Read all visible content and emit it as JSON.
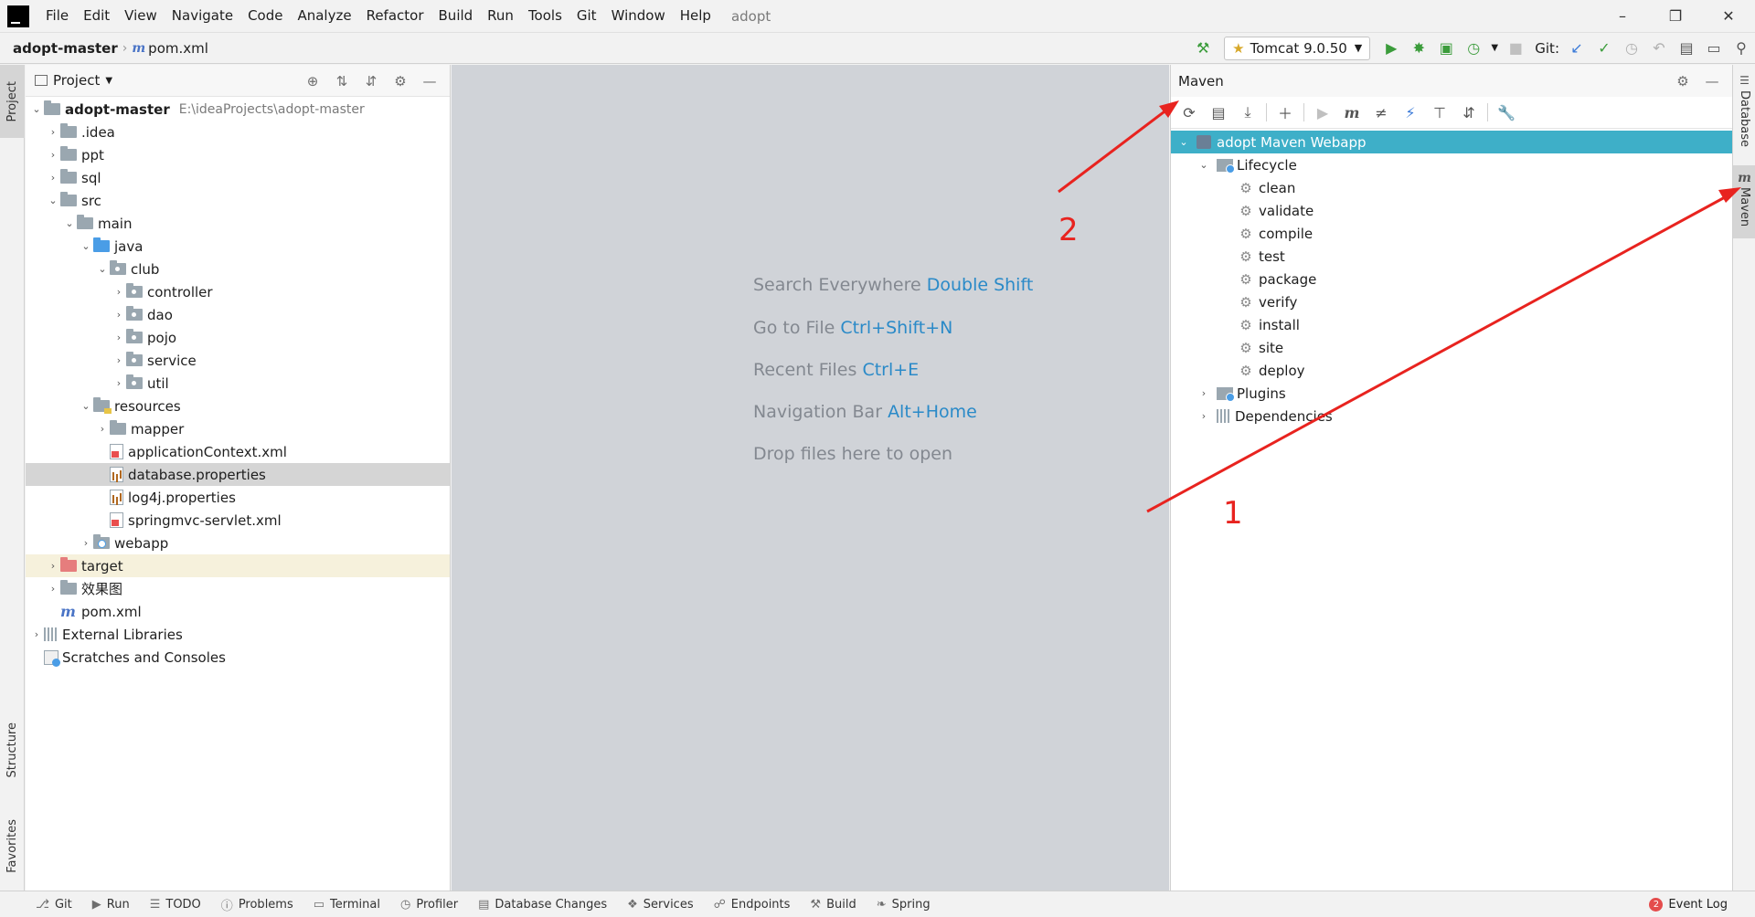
{
  "menubar": {
    "items": [
      "File",
      "Edit",
      "View",
      "Navigate",
      "Code",
      "Analyze",
      "Refactor",
      "Build",
      "Run",
      "Tools",
      "Git",
      "Window",
      "Help"
    ],
    "project_name": "adopt"
  },
  "navbar": {
    "root": "adopt-master",
    "file": "pom.xml",
    "run_config": "Tomcat 9.0.50",
    "git_label": "Git:"
  },
  "left_strip": {
    "project": "Project",
    "structure": "Structure",
    "favorites": "Favorites"
  },
  "right_strip": {
    "database": "Database",
    "maven": "Maven"
  },
  "project_panel": {
    "title": "Project",
    "root_path": "E:\\ideaProjects\\adopt-master",
    "tree": [
      {
        "label": "adopt-master",
        "depth": 0,
        "chev": "open",
        "icon": "module"
      },
      {
        "label": ".idea",
        "depth": 1,
        "chev": "closed",
        "icon": "folder"
      },
      {
        "label": "ppt",
        "depth": 1,
        "chev": "closed",
        "icon": "folder"
      },
      {
        "label": "sql",
        "depth": 1,
        "chev": "closed",
        "icon": "folder"
      },
      {
        "label": "src",
        "depth": 1,
        "chev": "open",
        "icon": "folder"
      },
      {
        "label": "main",
        "depth": 2,
        "chev": "open",
        "icon": "folder"
      },
      {
        "label": "java",
        "depth": 3,
        "chev": "open",
        "icon": "folder-blue"
      },
      {
        "label": "club",
        "depth": 4,
        "chev": "open",
        "icon": "package"
      },
      {
        "label": "controller",
        "depth": 5,
        "chev": "closed",
        "icon": "package"
      },
      {
        "label": "dao",
        "depth": 5,
        "chev": "closed",
        "icon": "package"
      },
      {
        "label": "pojo",
        "depth": 5,
        "chev": "closed",
        "icon": "package"
      },
      {
        "label": "service",
        "depth": 5,
        "chev": "closed",
        "icon": "package"
      },
      {
        "label": "util",
        "depth": 5,
        "chev": "closed",
        "icon": "package"
      },
      {
        "label": "resources",
        "depth": 3,
        "chev": "open",
        "icon": "resources"
      },
      {
        "label": "mapper",
        "depth": 4,
        "chev": "closed",
        "icon": "folder"
      },
      {
        "label": "applicationContext.xml",
        "depth": 4,
        "chev": "none",
        "icon": "xml"
      },
      {
        "label": "database.properties",
        "depth": 4,
        "chev": "none",
        "icon": "props",
        "selected": true
      },
      {
        "label": "log4j.properties",
        "depth": 4,
        "chev": "none",
        "icon": "props"
      },
      {
        "label": "springmvc-servlet.xml",
        "depth": 4,
        "chev": "none",
        "icon": "xml"
      },
      {
        "label": "webapp",
        "depth": 3,
        "chev": "closed",
        "icon": "web"
      },
      {
        "label": "target",
        "depth": 1,
        "chev": "closed",
        "icon": "folder-orange",
        "excluded": true
      },
      {
        "label": "效果图",
        "depth": 1,
        "chev": "closed",
        "icon": "folder"
      },
      {
        "label": "pom.xml",
        "depth": 1,
        "chev": "none",
        "icon": "maven"
      },
      {
        "label": "External Libraries",
        "depth": 0,
        "chev": "closed",
        "icon": "library"
      },
      {
        "label": "Scratches and Consoles",
        "depth": 0,
        "chev": "none",
        "icon": "scratch"
      }
    ]
  },
  "editor": {
    "hints": [
      {
        "text": "Search Everywhere",
        "key": "Double Shift"
      },
      {
        "text": "Go to File",
        "key": "Ctrl+Shift+N"
      },
      {
        "text": "Recent Files",
        "key": "Ctrl+E"
      },
      {
        "text": "Navigation Bar",
        "key": "Alt+Home"
      },
      {
        "text": "Drop files here to open",
        "key": ""
      }
    ]
  },
  "maven_panel": {
    "title": "Maven",
    "project": "adopt Maven Webapp",
    "lifecycle_label": "Lifecycle",
    "phases": [
      "clean",
      "validate",
      "compile",
      "test",
      "package",
      "verify",
      "install",
      "site",
      "deploy"
    ],
    "plugins_label": "Plugins",
    "dependencies_label": "Dependencies"
  },
  "annotations": {
    "label_1": "1",
    "label_2": "2",
    "color": "#e8231f"
  },
  "bottombar": {
    "items": [
      "Git",
      "Run",
      "TODO",
      "Problems",
      "Terminal",
      "Profiler",
      "Database Changes",
      "Services",
      "Endpoints",
      "Build",
      "Spring"
    ],
    "event_log": "Event Log",
    "event_count": "2"
  }
}
